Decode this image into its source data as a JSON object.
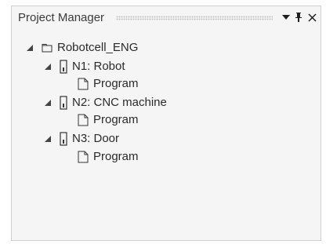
{
  "panel": {
    "title": "Project Manager",
    "buttons": {
      "dropdown": "▼",
      "pin": "ᵖ",
      "close": "✕"
    }
  },
  "tree": {
    "root": {
      "label": "Robotcell_ENG",
      "expanded": true,
      "icon": "folder-icon"
    },
    "nodes": [
      {
        "label": "N1: Robot",
        "icon": "device-icon",
        "expanded": true,
        "children": [
          {
            "label": "Program",
            "icon": "document-icon"
          }
        ]
      },
      {
        "label": "N2: CNC machine",
        "icon": "device-icon",
        "expanded": true,
        "children": [
          {
            "label": "Program",
            "icon": "document-icon"
          }
        ]
      },
      {
        "label": "N3: Door",
        "icon": "device-icon",
        "expanded": true,
        "children": [
          {
            "label": "Program",
            "icon": "document-icon"
          }
        ]
      }
    ]
  }
}
